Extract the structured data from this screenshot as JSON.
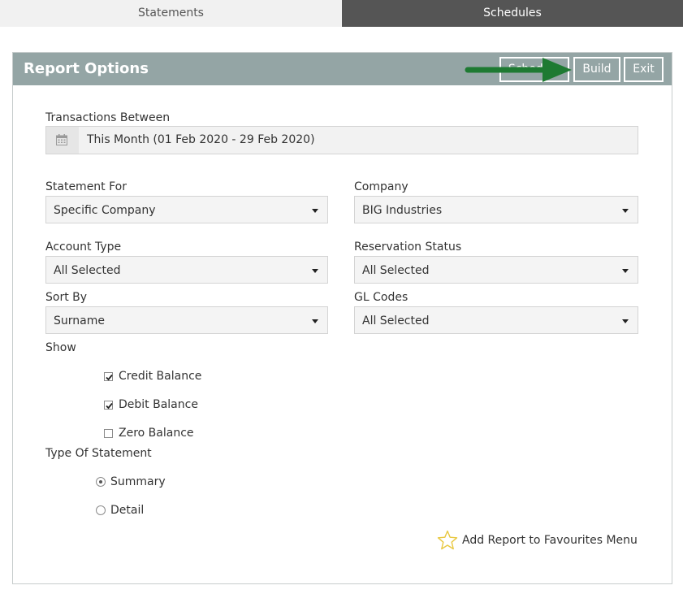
{
  "tabs": [
    {
      "label": "Statements",
      "active": true
    },
    {
      "label": "Schedules",
      "active": false
    }
  ],
  "panel": {
    "title": "Report Options",
    "buttons": {
      "schedule": "Schedule",
      "build": "Build",
      "exit": "Exit"
    }
  },
  "transactions": {
    "label": "Transactions Between",
    "icon": "calendar-icon",
    "value": "This Month (01 Feb 2020 - 29 Feb 2020)"
  },
  "fields": {
    "statement_for": {
      "label": "Statement For",
      "value": "Specific Company"
    },
    "company": {
      "label": "Company",
      "value": "BIG Industries"
    },
    "account_type": {
      "label": "Account Type",
      "value": "All Selected"
    },
    "reservation_status": {
      "label": "Reservation Status",
      "value": "All Selected"
    },
    "sort_by": {
      "label": "Sort By",
      "value": "Surname"
    },
    "gl_codes": {
      "label": "GL Codes",
      "value": "All Selected"
    }
  },
  "show": {
    "label": "Show",
    "options": [
      {
        "label": "Credit Balance",
        "checked": true
      },
      {
        "label": "Debit Balance",
        "checked": true
      },
      {
        "label": "Zero Balance",
        "checked": false
      }
    ]
  },
  "statement_type": {
    "label": "Type Of Statement",
    "options": [
      {
        "label": "Summary",
        "selected": true
      },
      {
        "label": "Detail",
        "selected": false
      }
    ]
  },
  "favourites": {
    "label": "Add Report to Favourites Menu",
    "icon": "star-outline-icon"
  },
  "colors": {
    "header": "#94a5a5",
    "active_tab": "#f1f1f1",
    "inactive_tab": "#555555",
    "arrow": "#1e7a32",
    "star": "#e8c840"
  }
}
